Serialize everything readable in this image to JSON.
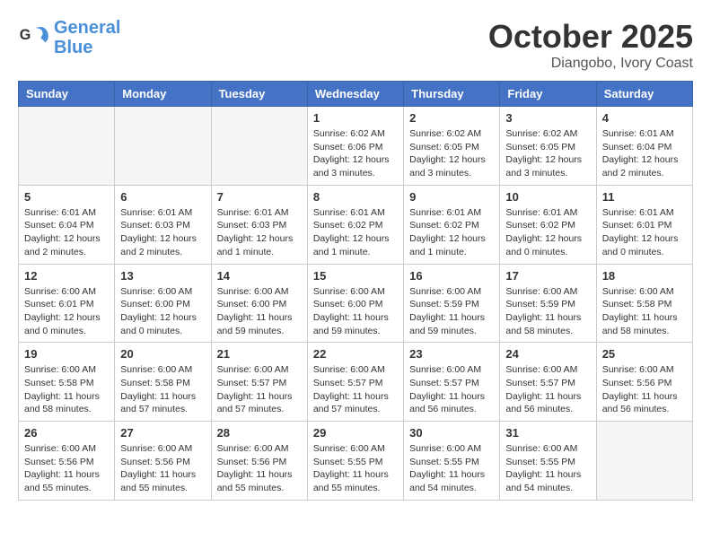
{
  "header": {
    "logo_line1": "General",
    "logo_line2": "Blue",
    "month": "October 2025",
    "location": "Diangobo, Ivory Coast"
  },
  "days_of_week": [
    "Sunday",
    "Monday",
    "Tuesday",
    "Wednesday",
    "Thursday",
    "Friday",
    "Saturday"
  ],
  "weeks": [
    [
      {
        "day": "",
        "info": ""
      },
      {
        "day": "",
        "info": ""
      },
      {
        "day": "",
        "info": ""
      },
      {
        "day": "1",
        "info": "Sunrise: 6:02 AM\nSunset: 6:06 PM\nDaylight: 12 hours and 3 minutes."
      },
      {
        "day": "2",
        "info": "Sunrise: 6:02 AM\nSunset: 6:05 PM\nDaylight: 12 hours and 3 minutes."
      },
      {
        "day": "3",
        "info": "Sunrise: 6:02 AM\nSunset: 6:05 PM\nDaylight: 12 hours and 3 minutes."
      },
      {
        "day": "4",
        "info": "Sunrise: 6:01 AM\nSunset: 6:04 PM\nDaylight: 12 hours and 2 minutes."
      }
    ],
    [
      {
        "day": "5",
        "info": "Sunrise: 6:01 AM\nSunset: 6:04 PM\nDaylight: 12 hours and 2 minutes."
      },
      {
        "day": "6",
        "info": "Sunrise: 6:01 AM\nSunset: 6:03 PM\nDaylight: 12 hours and 2 minutes."
      },
      {
        "day": "7",
        "info": "Sunrise: 6:01 AM\nSunset: 6:03 PM\nDaylight: 12 hours and 1 minute."
      },
      {
        "day": "8",
        "info": "Sunrise: 6:01 AM\nSunset: 6:02 PM\nDaylight: 12 hours and 1 minute."
      },
      {
        "day": "9",
        "info": "Sunrise: 6:01 AM\nSunset: 6:02 PM\nDaylight: 12 hours and 1 minute."
      },
      {
        "day": "10",
        "info": "Sunrise: 6:01 AM\nSunset: 6:02 PM\nDaylight: 12 hours and 0 minutes."
      },
      {
        "day": "11",
        "info": "Sunrise: 6:01 AM\nSunset: 6:01 PM\nDaylight: 12 hours and 0 minutes."
      }
    ],
    [
      {
        "day": "12",
        "info": "Sunrise: 6:00 AM\nSunset: 6:01 PM\nDaylight: 12 hours and 0 minutes."
      },
      {
        "day": "13",
        "info": "Sunrise: 6:00 AM\nSunset: 6:00 PM\nDaylight: 12 hours and 0 minutes."
      },
      {
        "day": "14",
        "info": "Sunrise: 6:00 AM\nSunset: 6:00 PM\nDaylight: 11 hours and 59 minutes."
      },
      {
        "day": "15",
        "info": "Sunrise: 6:00 AM\nSunset: 6:00 PM\nDaylight: 11 hours and 59 minutes."
      },
      {
        "day": "16",
        "info": "Sunrise: 6:00 AM\nSunset: 5:59 PM\nDaylight: 11 hours and 59 minutes."
      },
      {
        "day": "17",
        "info": "Sunrise: 6:00 AM\nSunset: 5:59 PM\nDaylight: 11 hours and 58 minutes."
      },
      {
        "day": "18",
        "info": "Sunrise: 6:00 AM\nSunset: 5:58 PM\nDaylight: 11 hours and 58 minutes."
      }
    ],
    [
      {
        "day": "19",
        "info": "Sunrise: 6:00 AM\nSunset: 5:58 PM\nDaylight: 11 hours and 58 minutes."
      },
      {
        "day": "20",
        "info": "Sunrise: 6:00 AM\nSunset: 5:58 PM\nDaylight: 11 hours and 57 minutes."
      },
      {
        "day": "21",
        "info": "Sunrise: 6:00 AM\nSunset: 5:57 PM\nDaylight: 11 hours and 57 minutes."
      },
      {
        "day": "22",
        "info": "Sunrise: 6:00 AM\nSunset: 5:57 PM\nDaylight: 11 hours and 57 minutes."
      },
      {
        "day": "23",
        "info": "Sunrise: 6:00 AM\nSunset: 5:57 PM\nDaylight: 11 hours and 56 minutes."
      },
      {
        "day": "24",
        "info": "Sunrise: 6:00 AM\nSunset: 5:57 PM\nDaylight: 11 hours and 56 minutes."
      },
      {
        "day": "25",
        "info": "Sunrise: 6:00 AM\nSunset: 5:56 PM\nDaylight: 11 hours and 56 minutes."
      }
    ],
    [
      {
        "day": "26",
        "info": "Sunrise: 6:00 AM\nSunset: 5:56 PM\nDaylight: 11 hours and 55 minutes."
      },
      {
        "day": "27",
        "info": "Sunrise: 6:00 AM\nSunset: 5:56 PM\nDaylight: 11 hours and 55 minutes."
      },
      {
        "day": "28",
        "info": "Sunrise: 6:00 AM\nSunset: 5:56 PM\nDaylight: 11 hours and 55 minutes."
      },
      {
        "day": "29",
        "info": "Sunrise: 6:00 AM\nSunset: 5:55 PM\nDaylight: 11 hours and 55 minutes."
      },
      {
        "day": "30",
        "info": "Sunrise: 6:00 AM\nSunset: 5:55 PM\nDaylight: 11 hours and 54 minutes."
      },
      {
        "day": "31",
        "info": "Sunrise: 6:00 AM\nSunset: 5:55 PM\nDaylight: 11 hours and 54 minutes."
      },
      {
        "day": "",
        "info": ""
      }
    ]
  ]
}
